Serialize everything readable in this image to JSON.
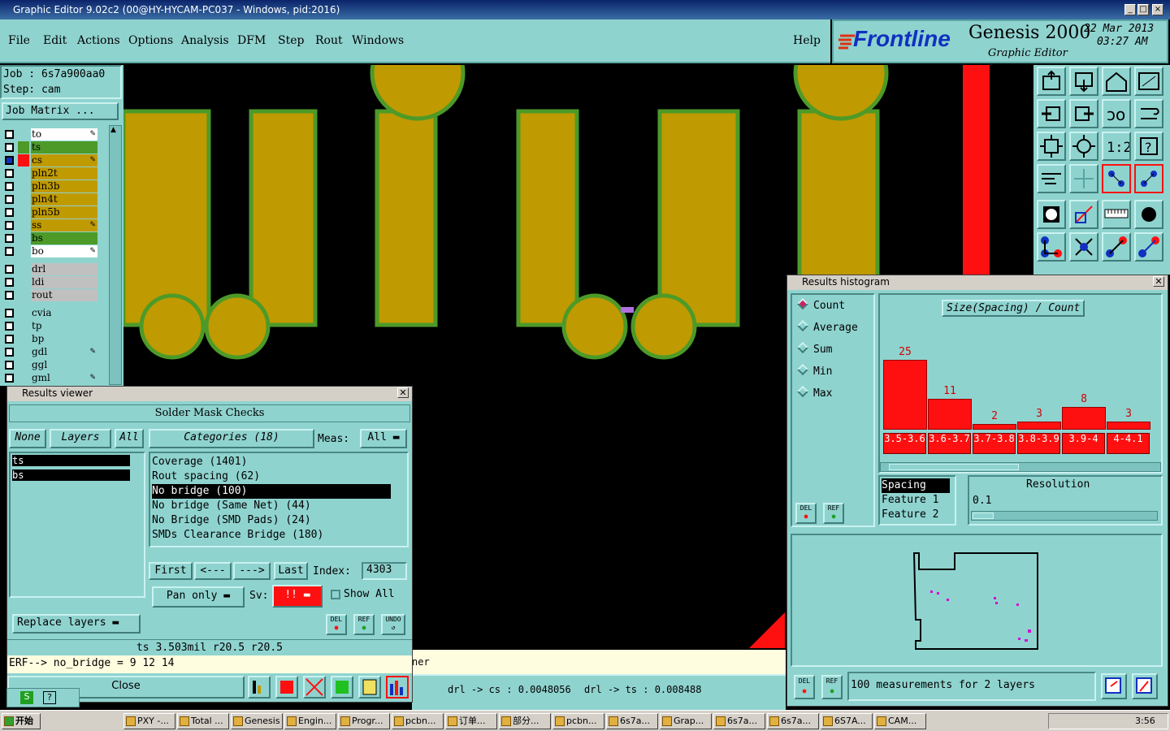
{
  "window": {
    "title": "Graphic Editor 9.02c2 (00@HY-HYCAM-PC037 - Windows, pid:2016)"
  },
  "menu": {
    "items": [
      "File",
      "Edit",
      "Actions",
      "Options",
      "Analysis",
      "DFM",
      "Step",
      "Rout",
      "Windows"
    ],
    "help": "Help"
  },
  "brand": {
    "logo": "Frontline",
    "product": "Genesis 2000",
    "subtitle": "Graphic Editor",
    "date": "22 Mar 2013",
    "time": "03:27 AM"
  },
  "job": {
    "job_label": "Job : 6s7a900aa0",
    "step_label": "Step: cam",
    "matrix_button": "Job Matrix ..."
  },
  "layers": [
    {
      "name": "to",
      "color": "#ffffff",
      "checked": false,
      "edit": true
    },
    {
      "name": "ts",
      "color": "#4d9a28",
      "checked": false,
      "edit": false
    },
    {
      "name": "cs",
      "color": "#bf9a00",
      "checked": true,
      "edit": true
    },
    {
      "name": "pln2t",
      "color": "#bf9a00",
      "checked": false,
      "edit": false
    },
    {
      "name": "pln3b",
      "color": "#bf9a00",
      "checked": false,
      "edit": false
    },
    {
      "name": "pln4t",
      "color": "#bf9a00",
      "checked": false,
      "edit": false
    },
    {
      "name": "pln5b",
      "color": "#bf9a00",
      "checked": false,
      "edit": false
    },
    {
      "name": "ss",
      "color": "#bf9a00",
      "checked": false,
      "edit": true
    },
    {
      "name": "bs",
      "color": "#4d9a28",
      "checked": false,
      "edit": false
    },
    {
      "name": "bo",
      "color": "#ffffff",
      "checked": false,
      "edit": true
    },
    {
      "name": "drl",
      "color": "#c0c0c0",
      "checked": false,
      "edit": false
    },
    {
      "name": "ldi",
      "color": "#c0c0c0",
      "checked": false,
      "edit": false
    },
    {
      "name": "rout",
      "color": "#c0c0c0",
      "checked": false,
      "edit": false
    },
    {
      "name": "cvia",
      "color": "#8fd3cf",
      "checked": false,
      "edit": false
    },
    {
      "name": "tp",
      "color": "#8fd3cf",
      "checked": false,
      "edit": false
    },
    {
      "name": "bp",
      "color": "#8fd3cf",
      "checked": false,
      "edit": false
    },
    {
      "name": "gdl",
      "color": "#8fd3cf",
      "checked": false,
      "edit": true
    },
    {
      "name": "ggl",
      "color": "#8fd3cf",
      "checked": false,
      "edit": false
    },
    {
      "name": "gml",
      "color": "#8fd3cf",
      "checked": false,
      "edit": true
    }
  ],
  "results_viewer": {
    "title": "Results viewer",
    "header": "Solder Mask Checks",
    "none_btn": "None",
    "layers_btn": "Layers",
    "all_btn": "All",
    "layer_list": [
      "ts",
      "bs"
    ],
    "categories_btn": "Categories (18)",
    "meas_label": "Meas:",
    "meas_value": "All",
    "categories": [
      "Coverage (1401)",
      "Rout spacing (62)",
      "No bridge (100)",
      "No bridge (Same Net) (44)",
      "No Bridge (SMD Pads) (24)",
      "SMDs Clearance Bridge (180)"
    ],
    "selected_category": "No bridge (100)",
    "first": "First",
    "prev": "<---",
    "next": "--->",
    "last": "Last",
    "index_label": "Index:",
    "index_value": "4303",
    "pan_mode": "Pan only",
    "sv_label": "Sv:",
    "sv_value": "!!",
    "show_all": "Show All",
    "replace_layers": "Replace layers",
    "del": "DEL",
    "ref": "REF",
    "undo": "UNDO",
    "measure_line": "ts 3.503mil   r20.5   r20.5",
    "erf_line": "ERF--> no_bridge = 9 12 14",
    "close": "Close"
  },
  "histogram": {
    "title": "Results histogram",
    "options": [
      "Count",
      "Average",
      "Sum",
      "Min",
      "Max"
    ],
    "selected": "Count",
    "chart_title": "Size(Spacing) / Count",
    "fields": [
      "Spacing",
      "Feature 1",
      "Feature 2"
    ],
    "resolution_label": "Resolution",
    "resolution_value": "0.1",
    "summary": "100 measurements for 2 layers",
    "del": "DEL",
    "ref": "REF"
  },
  "chart_data": {
    "type": "bar",
    "title": "Size(Spacing) / Count",
    "categories": [
      "3.5-3.6",
      "3.6-3.7",
      "3.7-3.8",
      "3.8-3.9",
      "3.9-4",
      "4-4.1"
    ],
    "values": [
      25,
      11,
      2,
      3,
      8,
      3
    ],
    "ylim": [
      0,
      25
    ]
  },
  "status": {
    "left_partial": "ner",
    "drl_cs": "drl -> cs : 0.0048056",
    "drl_ts": "drl -> ts : 0.008488"
  },
  "taskbar": {
    "start": "开始",
    "clock": "3:56",
    "tasks": [
      "PXY -...",
      "Total ...",
      "Genesis",
      "Engin...",
      "Progr...",
      "pcbn...",
      "订单...",
      "部分...",
      "pcbn...",
      "6s7a...",
      "Grap...",
      "6s7a...",
      "6s7a...",
      "6S7A...",
      "CAM..."
    ]
  }
}
